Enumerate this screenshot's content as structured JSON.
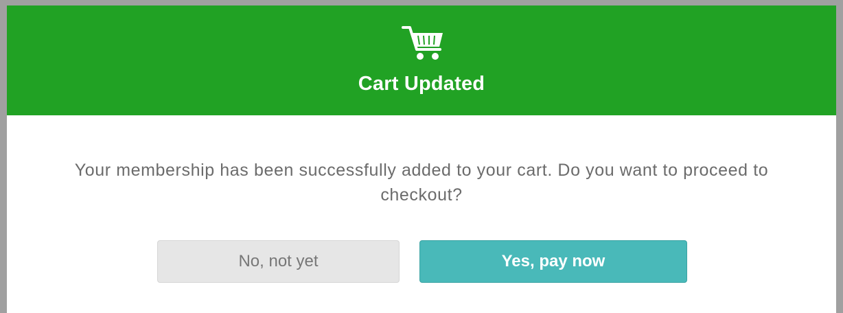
{
  "dialog": {
    "header_color": "#21a224",
    "icon": "shopping-cart-icon",
    "title": "Cart Updated",
    "message": "Your membership has been successfully added to your cart. Do you want to proceed to checkout?"
  },
  "buttons": {
    "decline_label": "No, not yet",
    "confirm_label": "Yes, pay now",
    "confirm_color": "#49b9b9"
  }
}
